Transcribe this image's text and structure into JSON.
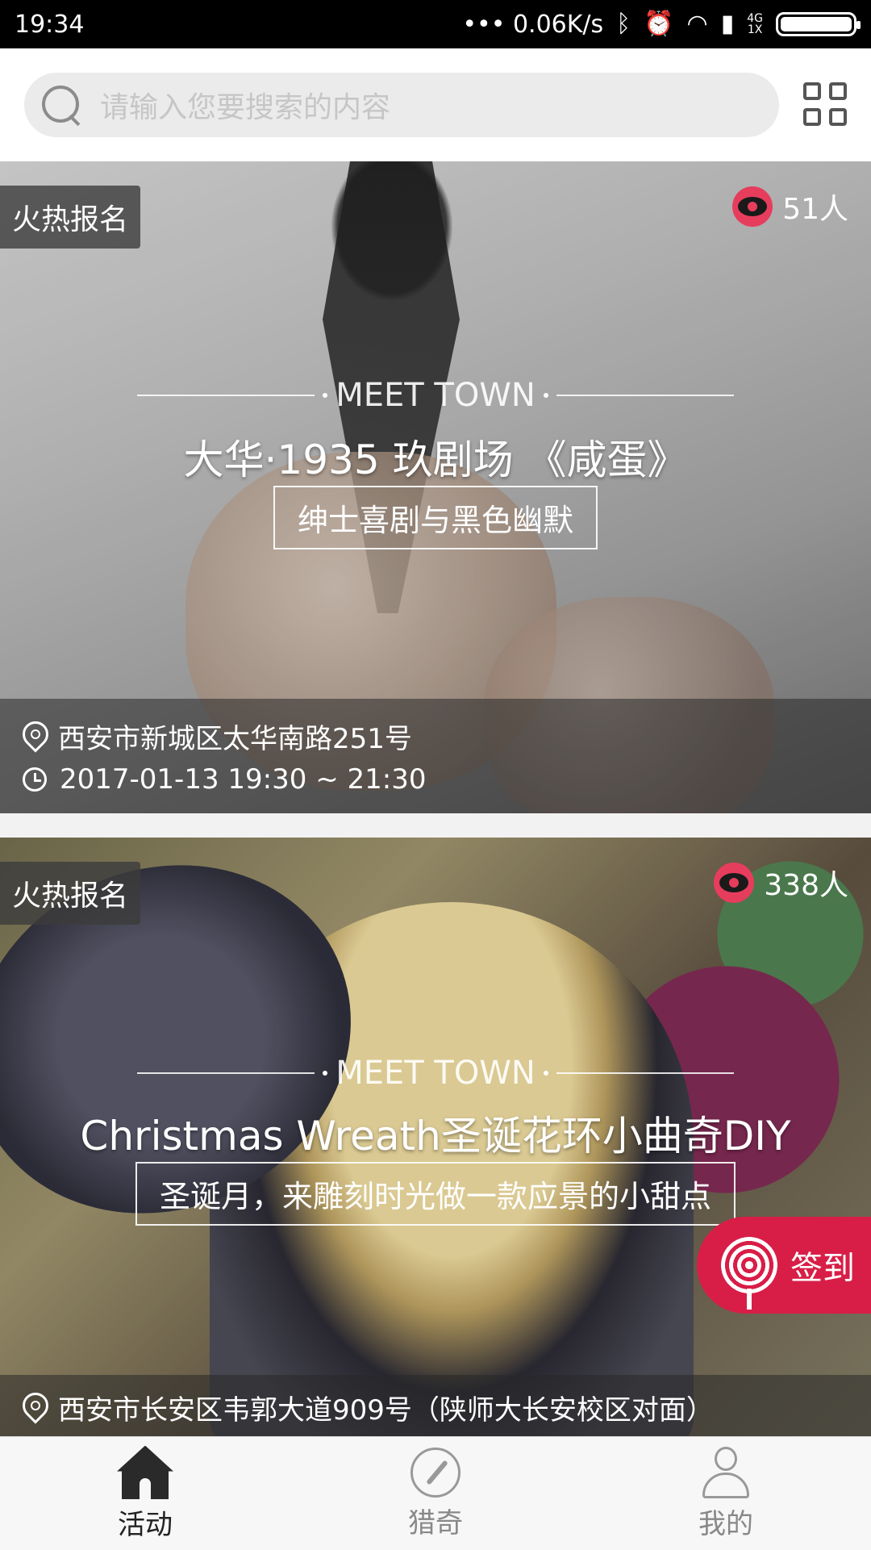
{
  "status_bar": {
    "time": "19:34",
    "net_speed": "••• 0.06K/s",
    "bluetooth_icon": "bluetooth-icon",
    "alarm_icon": "alarm-icon",
    "net_type_top": "4G",
    "net_type_bottom": "1X"
  },
  "search": {
    "placeholder": "请输入您要搜索的内容",
    "icon": "search-icon",
    "grid_icon": "grid-menu-icon"
  },
  "brand_tag": "MEET TOWN",
  "events": [
    {
      "badge": "火热报名",
      "views": "51人",
      "title": "大华·1935 玖剧场 《咸蛋》",
      "subtitle": "绅士喜剧与黑色幽默",
      "address": "西安市新城区太华南路251号",
      "time": "2017-01-13 19:30 ~ 21:30"
    },
    {
      "badge": "火热报名",
      "views": "338人",
      "title": "Christmas Wreath圣诞花环小曲奇DIY",
      "subtitle": "圣诞月，来雕刻时光做一款应景的小甜点",
      "address": "西安市长安区韦郭大道909号（陕师大长安校区对面）"
    }
  ],
  "checkin": {
    "label": "签到"
  },
  "bottom_nav": [
    {
      "label": "活动",
      "icon": "home-icon",
      "active": true
    },
    {
      "label": "猎奇",
      "icon": "compass-icon",
      "active": false
    },
    {
      "label": "我的",
      "icon": "user-icon",
      "active": false
    }
  ],
  "colors": {
    "accent": "#d81e47",
    "eye_badge": "#e63d5d"
  }
}
